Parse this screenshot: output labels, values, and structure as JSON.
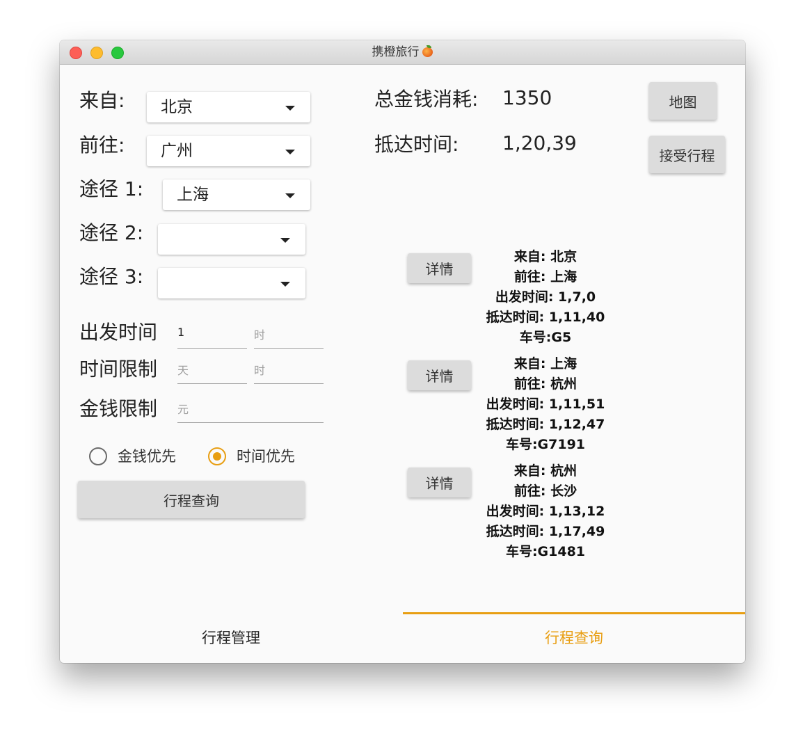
{
  "window": {
    "title": "携橙旅行",
    "title_icon": "orange-fruit-icon"
  },
  "form": {
    "from_label": "来自:",
    "from_value": "北京",
    "to_label": "前往:",
    "to_value": "广州",
    "via1_label": "途径 1:",
    "via1_value": "上海",
    "via2_label": "途径 2:",
    "via2_value": "",
    "via3_label": "途径 3:",
    "via3_value": "",
    "depart_label": "出发时间",
    "depart_day_value": "1",
    "depart_hour_placeholder": "时",
    "limit_label": "时间限制",
    "limit_day_placeholder": "天",
    "limit_hour_placeholder": "时",
    "money_label": "金钱限制",
    "money_placeholder": "元",
    "radio_money_label": "金钱优先",
    "radio_time_label": "时间优先",
    "radio_selected": "time",
    "query_button": "行程查询"
  },
  "summary": {
    "cost_label": "总金钱消耗:",
    "cost_value": "1350",
    "arrive_label": "抵达时间:",
    "arrive_value": "1,20,39",
    "map_button": "地图",
    "accept_button": "接受行程"
  },
  "trips": [
    {
      "detail_label": "详情",
      "from": "来自: 北京",
      "to": "前往: 上海",
      "depart": "出发时间: 1,7,0",
      "arrive": "抵达时间: 1,11,40",
      "train": "车号:G5"
    },
    {
      "detail_label": "详情",
      "from": "来自: 上海",
      "to": "前往: 杭州",
      "depart": "出发时间: 1,11,51",
      "arrive": "抵达时间: 1,12,47",
      "train": "车号:G7191"
    },
    {
      "detail_label": "详情",
      "from": "来自: 杭州",
      "to": "前往: 长沙",
      "depart": "出发时间: 1,13,12",
      "arrive": "抵达时间: 1,17,49",
      "train": "车号:G1481"
    }
  ],
  "tabs": {
    "manage": "行程管理",
    "query": "行程查询",
    "active": "query"
  },
  "colors": {
    "accent": "#e89e12",
    "button_bg": "#dcdcdc",
    "background": "#fafafa"
  }
}
